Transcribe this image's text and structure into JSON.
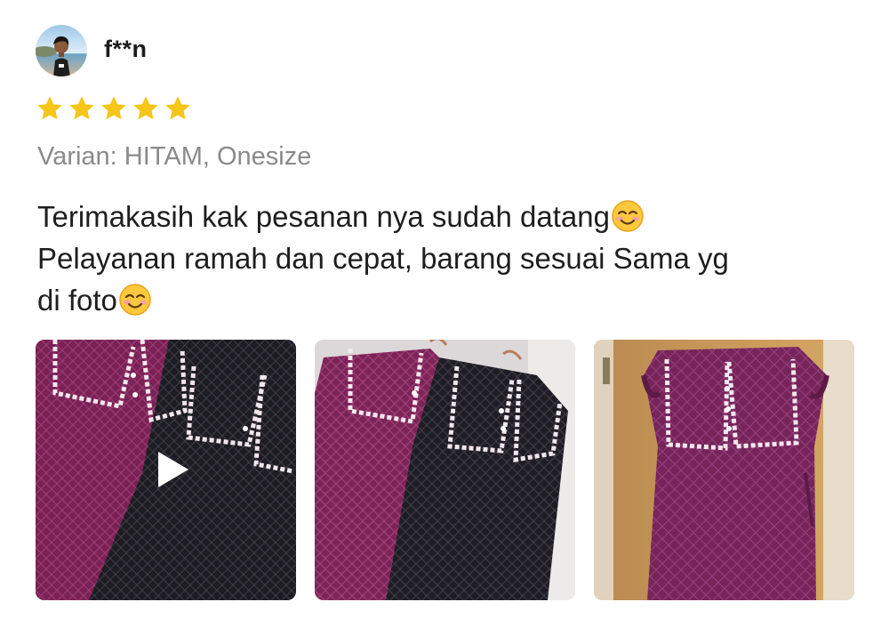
{
  "reviewer": {
    "name": "f**n",
    "avatar": "reviewer-avatar"
  },
  "rating": {
    "value": 5,
    "max": 5,
    "star_color": "#f5c518"
  },
  "variant": {
    "text": "Varian: HITAM, Onesize"
  },
  "review": {
    "line1": "Terimakasih kak pesanan nya sudah datang",
    "line2": "Pelayanan ramah dan cepat, barang sesuai Sama yg",
    "line3": "di foto",
    "emoji": "smiling-face-emoji"
  },
  "media": [
    {
      "type": "video",
      "icon": "play-icon",
      "subject": "purple and black lace dresses"
    },
    {
      "type": "photo",
      "subject": "purple and black lace dresses on hangers"
    },
    {
      "type": "photo",
      "subject": "purple lace dress on door"
    }
  ],
  "colors": {
    "text": "#1e1e1e",
    "muted": "#8a8a8a",
    "star": "#f5c518",
    "dress_purple": "#7a2155",
    "dress_black": "#1d1c22"
  }
}
